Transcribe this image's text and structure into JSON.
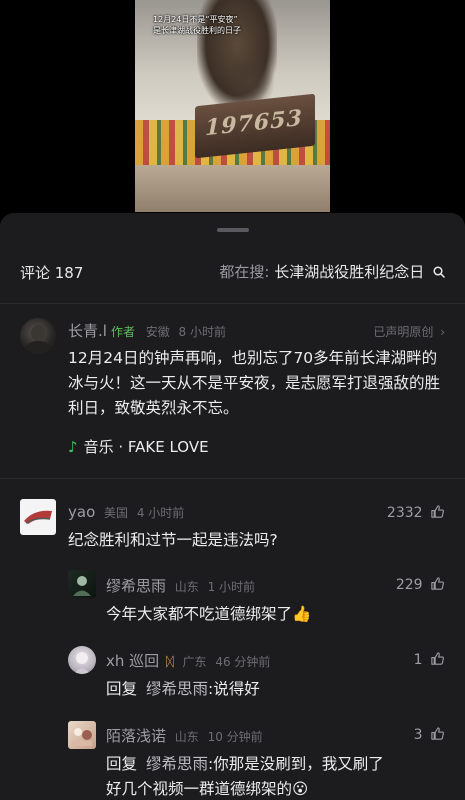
{
  "video": {
    "caption_line1": "12月24日不是“平安夜”",
    "caption_line2": "是长津湖战役胜利的日子",
    "plaque_number": "197653"
  },
  "sheet": {
    "comment_count": "评论 187",
    "search_prefix": "都在搜:",
    "search_term": "长津湖战役胜利纪念日",
    "search_icon": "search-icon"
  },
  "comments": [
    {
      "username": "长青.l",
      "author_tag": "作者",
      "location": "安徽",
      "time": "8 小时前",
      "declared": "已声明原创",
      "text": "12月24日的钟声再响，也别忘了70多年前长津湖畔的冰与火！这一天从不是平安夜，是志愿军打退强敌的胜利日，致敬英烈永不忘。",
      "music_label": "音乐 · FAKE LOVE"
    },
    {
      "username": "yao",
      "location": "美国",
      "time": "4 小时前",
      "likes": "2332",
      "text": "纪念胜利和过节一起是违法吗?"
    }
  ],
  "replies": [
    {
      "username": "缪希思雨",
      "location": "山东",
      "time": "1 小时前",
      "likes": "229",
      "text": "今年大家都不吃道德绑架了👍"
    },
    {
      "username": "xh 巡回",
      "location": "广东",
      "time": "46 分钟前",
      "likes": "1",
      "reply_prefix": "回复",
      "reply_target": "缪希思雨",
      "text": ":说得好"
    },
    {
      "username": "陌落浅诺",
      "location": "山东",
      "time": "10 分钟前",
      "likes": "3",
      "reply_prefix": "回复",
      "reply_target": "缪希思雨",
      "text_line1": ":你那是没刷到，我又刷了",
      "text_line2": "好几个视频一群道德绑架的😮"
    }
  ],
  "colors": {
    "sheet_bg": "#1c1c1e",
    "author_tag": "#5fbf5f",
    "music_note": "#39c75c",
    "muted": "#6d6d72"
  }
}
